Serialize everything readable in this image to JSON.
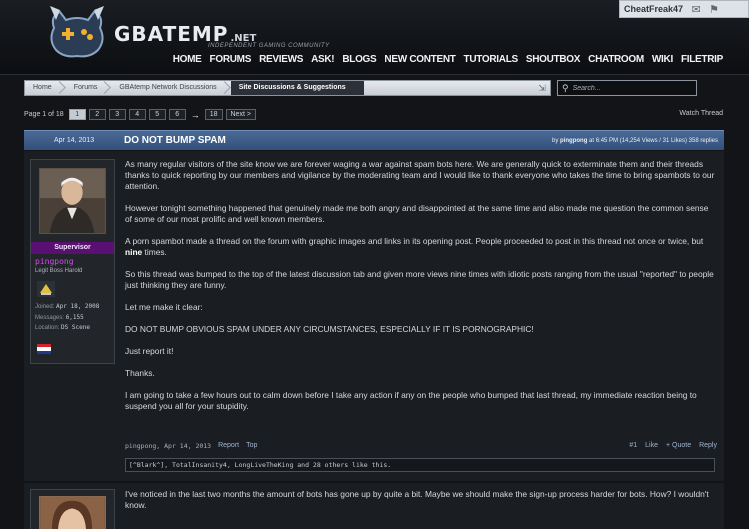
{
  "site": {
    "logo": "GBATEMP",
    "logo_suffix": ".NET",
    "tagline": "INDEPENDENT GAMING COMMUNITY"
  },
  "user_box": {
    "username": "CheatFreak47",
    "icons": [
      "inbox-icon",
      "alerts-icon"
    ]
  },
  "nav": [
    "HOME",
    "FORUMS",
    "REVIEWS",
    "ASK!",
    "BLOGS",
    "NEW CONTENT",
    "TUTORIALS",
    "SHOUTBOX",
    "CHATROOM",
    "WIKI",
    "FILETRIP"
  ],
  "breadcrumb": [
    "Home",
    "Forums",
    "GBAtemp Network Discussions",
    "Site Discussions & Suggestions"
  ],
  "search": {
    "placeholder": "Search..."
  },
  "pager": {
    "label": "Page 1 of 18",
    "pages": [
      "1",
      "2",
      "3",
      "4",
      "5",
      "6"
    ],
    "gap": "→",
    "last": "18",
    "next": "Next >",
    "current": "1"
  },
  "watch_label": "Watch Thread",
  "thread": {
    "date": "Apr 14, 2013",
    "title": "DO NOT BUMP SPAM",
    "meta_prefix": "by",
    "author": "pingpong",
    "meta_time": "at 6:45 PM",
    "meta_stats": "(14,254 Views / 31 Likes) 358 replies"
  },
  "post1": {
    "user": {
      "role": "Supervisor",
      "name": "pingpong",
      "title": "Legit Boss Harold",
      "joined_label": "Joined:",
      "joined_value": "Apr 18, 2008",
      "messages_label": "Messages:",
      "messages_value": "6,155",
      "location_label": "Location:",
      "location_value": "DS Scene"
    },
    "paragraphs": {
      "p1": "As many regular visitors of the site know we are forever waging a war against spam bots here. We are generally quick to exterminate them and their threads thanks to quick reporting by our members and vigilance by the moderating team and I would like to thank everyone who takes the time to bring spambots to our attention.",
      "p2": "However tonight something happened that genuinely made me both angry and disappointed at the same time and also made me question the common sense of some of our most prolific and well known members.",
      "p3_a": "A porn spambot made a thread on the forum with graphic images and links in its opening post. People proceeded to post in this thread not once or twice, but ",
      "p3_b": "nine",
      "p3_c": " times.",
      "p4": "So this thread was bumped to the top of the latest discussion tab and given more views nine times with idiotic posts ranging from the usual \"reported\" to people just thinking they are funny.",
      "p5": "Let me make it clear:",
      "p6": "DO NOT BUMP OBVIOUS SPAM UNDER ANY CIRCUMSTANCES, ESPECIALLY IF IT IS PORNOGRAPHIC!",
      "p7": "Just report it!",
      "p8": "Thanks.",
      "p9": "I am going to take a few hours out to calm down before I take any action if any on the people who bumped that last thread, my immediate reaction being to suspend you all for your stupidity."
    },
    "footer": {
      "meta": "pingpong, Apr 14, 2013",
      "report": "Report",
      "top": "Top",
      "number": "#1",
      "like": "Like",
      "quote": "+ Quote",
      "reply": "Reply"
    },
    "likes": "[^Blark^], TotalInsanity4, LongLiveTheKing and 28 others like this."
  },
  "post2": {
    "text": "I've noticed in the last two months the amount of bots has gone up by quite a bit. Maybe we should make the sign-up process harder for bots. How? I wouldn't know."
  }
}
